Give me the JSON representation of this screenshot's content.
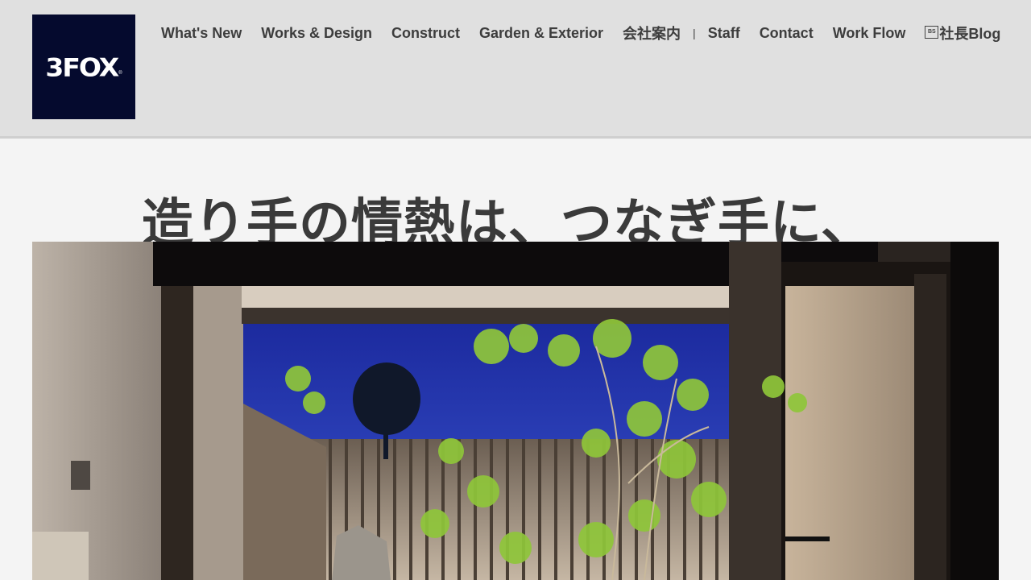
{
  "brand": {
    "logo_text": "3FOX",
    "logo_mark": "®"
  },
  "nav": {
    "items": [
      {
        "label": "What's New"
      },
      {
        "label": "Works & Design"
      },
      {
        "label": "Construct"
      },
      {
        "label": "Garden & Exterior"
      },
      {
        "label": "会社案内"
      },
      {
        "label": "Staff"
      },
      {
        "label": "Contact"
      },
      {
        "label": "Work Flow"
      },
      {
        "label": "社長Blog"
      }
    ],
    "separator": "|",
    "blog_icon_text": "BS"
  },
  "hero": {
    "headline": "造り手の情熱は、つなぎ手に、"
  },
  "colors": {
    "header_bg": "#e0e0e0",
    "logo_bg": "#050a2e",
    "page_bg": "#f4f4f4",
    "nav_text": "#3d3d3d",
    "sky": "#2a3fb0",
    "foliage": "#8fc63a"
  }
}
